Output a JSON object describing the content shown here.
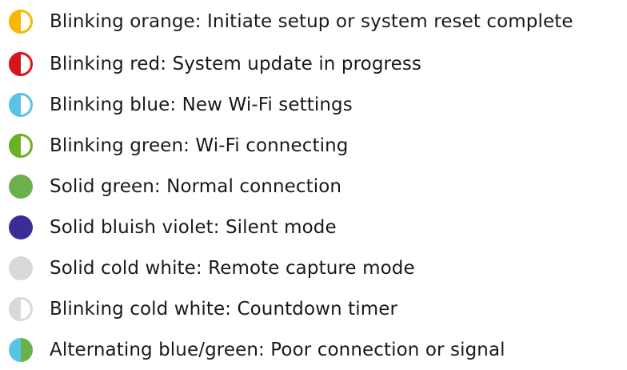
{
  "legend": {
    "items": [
      {
        "text": "Blinking orange: Initiate setup or system reset complete",
        "icon": "half-filled-circle-icon",
        "pattern": "half",
        "color": "#f6b900"
      },
      {
        "text": "Blinking red: System update in progress",
        "icon": "half-filled-circle-icon",
        "pattern": "half",
        "color": "#d7141a"
      },
      {
        "text": "Blinking blue: New Wi-Fi settings",
        "icon": "half-filled-circle-icon",
        "pattern": "half",
        "color": "#5bc2e7"
      },
      {
        "text": "Blinking green: Wi-Fi connecting",
        "icon": "half-filled-circle-icon",
        "pattern": "half",
        "color": "#6ab023"
      },
      {
        "text": "Solid green: Normal connection",
        "icon": "filled-circle-icon",
        "pattern": "solid",
        "color": "#6ab04c"
      },
      {
        "text": "Solid bluish violet: Silent mode",
        "icon": "filled-circle-icon",
        "pattern": "solid",
        "color": "#3a2e96"
      },
      {
        "text": "Solid cold white: Remote capture mode",
        "icon": "filled-circle-icon",
        "pattern": "solid",
        "color": "#d9d9d9"
      },
      {
        "text": "Blinking cold white: Countdown timer",
        "icon": "half-filled-circle-icon",
        "pattern": "half",
        "color": "#d9d9d9"
      },
      {
        "text": "Alternating blue/green: Poor connection or signal",
        "icon": "split-circle-icon",
        "pattern": "split",
        "color": "#5bc2e7",
        "color2": "#6ab04c"
      }
    ]
  }
}
